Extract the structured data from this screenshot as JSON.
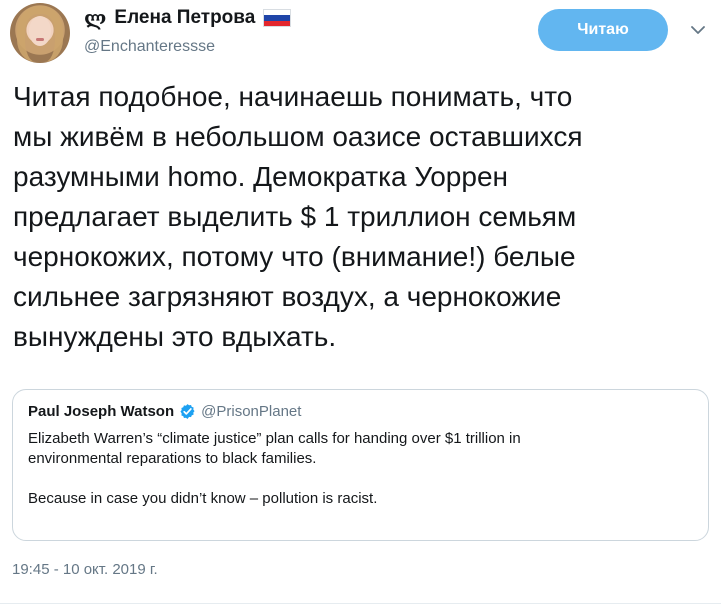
{
  "tweet": {
    "author": {
      "script_symbol": "ლ",
      "name": "Елена Петрова",
      "handle": "@Enchanteressse",
      "flag": "russia-flag-icon"
    },
    "follow_button_label": "Читаю",
    "body": "Читая подобное, начинаешь понимать, что\nмы живём в небольшом оазисе оставшихся\nразумными homo. Демократка Уоррен\nпредлагает выделить $ 1 триллион семьям\nчернокожих, потому что (внимание!) белые\nсильнее загрязняют воздух, а чернокожие\nвынуждены это вдыхать.",
    "timestamp": "19:45 - 10 окт. 2019 г."
  },
  "quoted_tweet": {
    "name": "Paul Joseph Watson",
    "handle": "@PrisonPlanet",
    "verified": true,
    "text": "Elizabeth Warren’s “climate justice” plan calls for handing over $1 trillion in\nenvironmental reparations to black families.\n\nBecause in case you didn’t know – pollution is racist."
  },
  "colors": {
    "follow_button": "#62b6f0",
    "secondary_text": "#657786",
    "verified": "#1da1f2",
    "border": "#ccd6dd"
  },
  "flag_colors": [
    "#ffffff",
    "#1f45a8",
    "#e3262d"
  ]
}
